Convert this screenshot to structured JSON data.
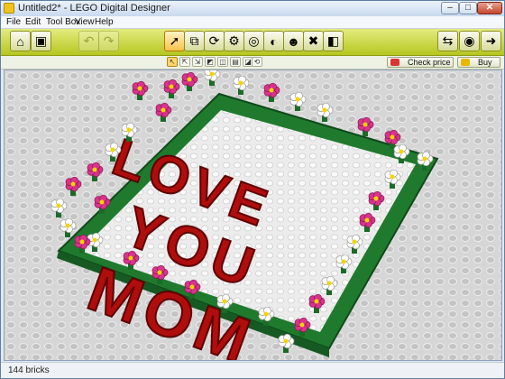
{
  "window": {
    "title": "Untitled2* - LEGO Digital Designer"
  },
  "title_buttons": {
    "minimize": "–",
    "maximize": "□",
    "close": "✕"
  },
  "menu": {
    "items": [
      "File",
      "Edit",
      "Tool Box",
      "View",
      "Help"
    ]
  },
  "toolbar": {
    "left_tools": [
      {
        "name": "home-button",
        "icon": "home-icon",
        "glyph": "⌂"
      },
      {
        "name": "save-button",
        "icon": "save-icon",
        "glyph": "▣"
      },
      {
        "name": "undo-button",
        "icon": "undo-icon",
        "glyph": "↶",
        "enabled": false
      },
      {
        "name": "redo-button",
        "icon": "redo-icon",
        "glyph": "↷",
        "enabled": false
      }
    ],
    "center_tools": [
      {
        "name": "select-tool",
        "icon": "cursor-arrow-icon",
        "glyph": "➚",
        "selected": true
      },
      {
        "name": "clone-tool",
        "icon": "clone-icon",
        "glyph": "⧉"
      },
      {
        "name": "hinge-tool",
        "icon": "hinge-icon",
        "glyph": "⟳"
      },
      {
        "name": "hinge-align-tool",
        "icon": "hinge-align-icon",
        "glyph": "⚙"
      },
      {
        "name": "flex-tool",
        "icon": "flex-icon",
        "glyph": "◎"
      },
      {
        "name": "paint-tool",
        "icon": "paint-bucket-icon",
        "glyph": "◐"
      },
      {
        "name": "decoration-tool",
        "icon": "minifig-head-icon",
        "glyph": "☻"
      },
      {
        "name": "delete-tool",
        "icon": "delete-icon",
        "glyph": "✖"
      },
      {
        "name": "hide-tool",
        "icon": "hide-brick-icon",
        "glyph": "◧"
      }
    ],
    "right_tools": [
      {
        "name": "build-mode-button",
        "icon": "build-mode-icon",
        "glyph": "⇆"
      },
      {
        "name": "view-mode-button",
        "icon": "view-mode-icon",
        "glyph": "◉"
      },
      {
        "name": "building-guide-button",
        "icon": "building-guide-icon",
        "glyph": "➜"
      }
    ]
  },
  "subtoolbar": {
    "select_modes": [
      {
        "name": "single-select-mode",
        "icon": "single-select-icon",
        "glyph": "↖",
        "selected": true
      },
      {
        "name": "multi-select-mode",
        "icon": "multi-select-icon",
        "glyph": "⇱"
      },
      {
        "name": "connected-select-mode",
        "icon": "connected-select-icon",
        "glyph": "⇲"
      },
      {
        "name": "color-select-mode",
        "icon": "color-select-icon",
        "glyph": "◩"
      },
      {
        "name": "shape-select-mode",
        "icon": "shape-select-icon",
        "glyph": "◫"
      },
      {
        "name": "same-brick-select-mode",
        "icon": "same-brick-select-icon",
        "glyph": "▤"
      },
      {
        "name": "invert-select-mode",
        "icon": "invert-select-icon",
        "glyph": "◪"
      }
    ],
    "extra_button": {
      "name": "group-select-button",
      "icon": "group-select-icon",
      "glyph": "⟲"
    },
    "check_price": "Check price",
    "buy": "Buy"
  },
  "scene": {
    "text_rows": [
      "LOVE",
      "YOU",
      "MOM"
    ],
    "colors": {
      "brick_red": "#b00d0d",
      "base_green": "#1f7a2e",
      "plate_white": "#f2f2f2",
      "flower_pink": "#d8338a",
      "flower_white": "#ffffff",
      "grid_gray": "#d8d8d8",
      "toolbar_green": "#c5d43a"
    }
  },
  "status": {
    "brick_count": "144 bricks"
  }
}
